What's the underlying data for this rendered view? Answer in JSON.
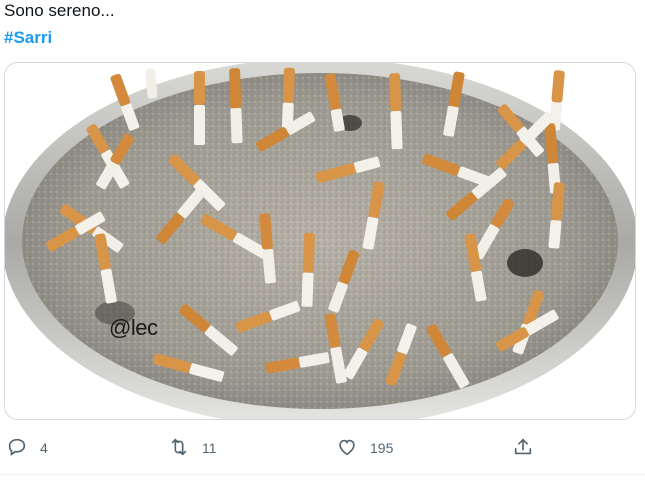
{
  "tweet": {
    "text": "Sono sereno...",
    "hashtag": "#Sarri"
  },
  "media": {
    "watermark": "@lec"
  },
  "actions": {
    "reply": {
      "icon": "reply-icon",
      "count": "4"
    },
    "retweet": {
      "icon": "retweet-icon",
      "count": "11"
    },
    "like": {
      "icon": "heart-icon",
      "count": "195"
    },
    "share": {
      "icon": "share-icon"
    }
  },
  "colors": {
    "text": "#0f1419",
    "hashtag": "#1d9bf0",
    "muted": "#536471",
    "border": "#cfd9de"
  }
}
